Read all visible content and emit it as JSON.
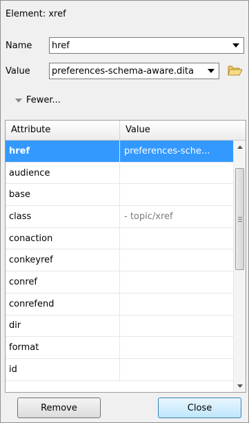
{
  "header": {
    "title": "Element: xref"
  },
  "name_field": {
    "label": "Name",
    "value": "href"
  },
  "value_field": {
    "label": "Value",
    "value": "preferences-schema-aware.dita"
  },
  "toggle": {
    "label": "Fewer..."
  },
  "table": {
    "columns": [
      "Attribute",
      "Value"
    ],
    "rows": [
      {
        "attribute": "href",
        "value": "preferences-sche...",
        "selected": true
      },
      {
        "attribute": "audience",
        "value": ""
      },
      {
        "attribute": "base",
        "value": ""
      },
      {
        "attribute": "class",
        "value": "- topic/xref"
      },
      {
        "attribute": "conaction",
        "value": ""
      },
      {
        "attribute": "conkeyref",
        "value": ""
      },
      {
        "attribute": "conref",
        "value": ""
      },
      {
        "attribute": "conrefend",
        "value": ""
      },
      {
        "attribute": "dir",
        "value": ""
      },
      {
        "attribute": "format",
        "value": ""
      },
      {
        "attribute": "id",
        "value": ""
      }
    ]
  },
  "buttons": {
    "remove": "Remove",
    "close": "Close"
  },
  "colors": {
    "selection": "#3399ff",
    "close_button": "#bee6fd"
  },
  "icons": {
    "open": "folder-open-icon"
  }
}
